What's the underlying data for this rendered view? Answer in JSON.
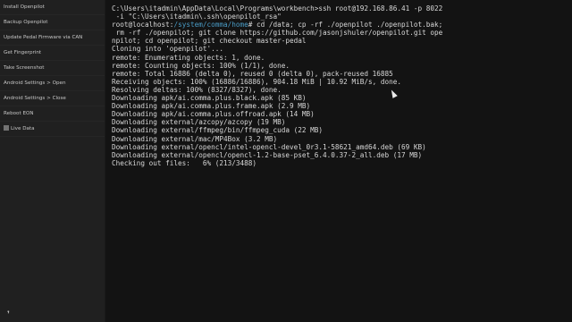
{
  "sidebar": {
    "items": [
      {
        "label": "Install Openpilot"
      },
      {
        "label": "Backup Openpilot"
      },
      {
        "label": "Update Pedal Firmware via CAN"
      },
      {
        "label": "Get Fingerprint"
      },
      {
        "label": "Take Screenshot"
      },
      {
        "label": "Android Settings > Open"
      },
      {
        "label": "Android Settings > Close"
      },
      {
        "label": "Reboot EON"
      },
      {
        "label": "Live Data",
        "icon": "list-icon"
      }
    ]
  },
  "terminal": {
    "lines": [
      "C:\\Users\\itadmin\\AppData\\Local\\Programs\\workbench>ssh root@192.168.86.41 -p 8022",
      " -i \"C:\\Users\\itadmin\\.ssh\\openpilot_rsa\"",
      "root@localhost:",
      " rm -rf ./openpilot; git clone https://github.com/jasonjshuler/openpilot.git ope",
      "npilot; cd openpilot; git checkout master-pedal",
      "Cloning into 'openpilot'...",
      "remote: Enumerating objects: 1, done.",
      "remote: Counting objects: 100% (1/1), done.",
      "remote: Total 16886 (delta 0), reused 0 (delta 0), pack-reused 16885",
      "Receiving objects: 100% (16886/16886), 904.18 MiB | 10.92 MiB/s, done.",
      "Resolving deltas: 100% (8327/8327), done.",
      "Downloading apk/ai.comma.plus.black.apk (85 KB)",
      "Downloading apk/ai.comma.plus.frame.apk (2.9 MB)",
      "Downloading apk/ai.comma.plus.offroad.apk (14 MB)",
      "Downloading external/azcopy/azcopy (19 MB)",
      "Downloading external/ffmpeg/bin/ffmpeg_cuda (22 MB)",
      "Downloading external/mac/MP4Box (3.2 MB)",
      "Downloading external/opencl/intel-opencl-devel_0r3.1-58621_amd64.deb (69 KB)",
      "Downloading external/opencl/opencl-1.2-base-pset_6.4.0.37-2_all.deb (17 MB)",
      "Checking out files:   6% (213/3488)"
    ],
    "prompt_path": "/system/comma/home",
    "prompt_command": "# cd /data; cp -rf ./openpilot ./openpilot.bak;"
  },
  "bottom_glyph": "❜",
  "colors": {
    "background": "#131313",
    "sidebar_bg": "#202020",
    "text": "#d8d8d8",
    "path": "#4a9cc6"
  }
}
